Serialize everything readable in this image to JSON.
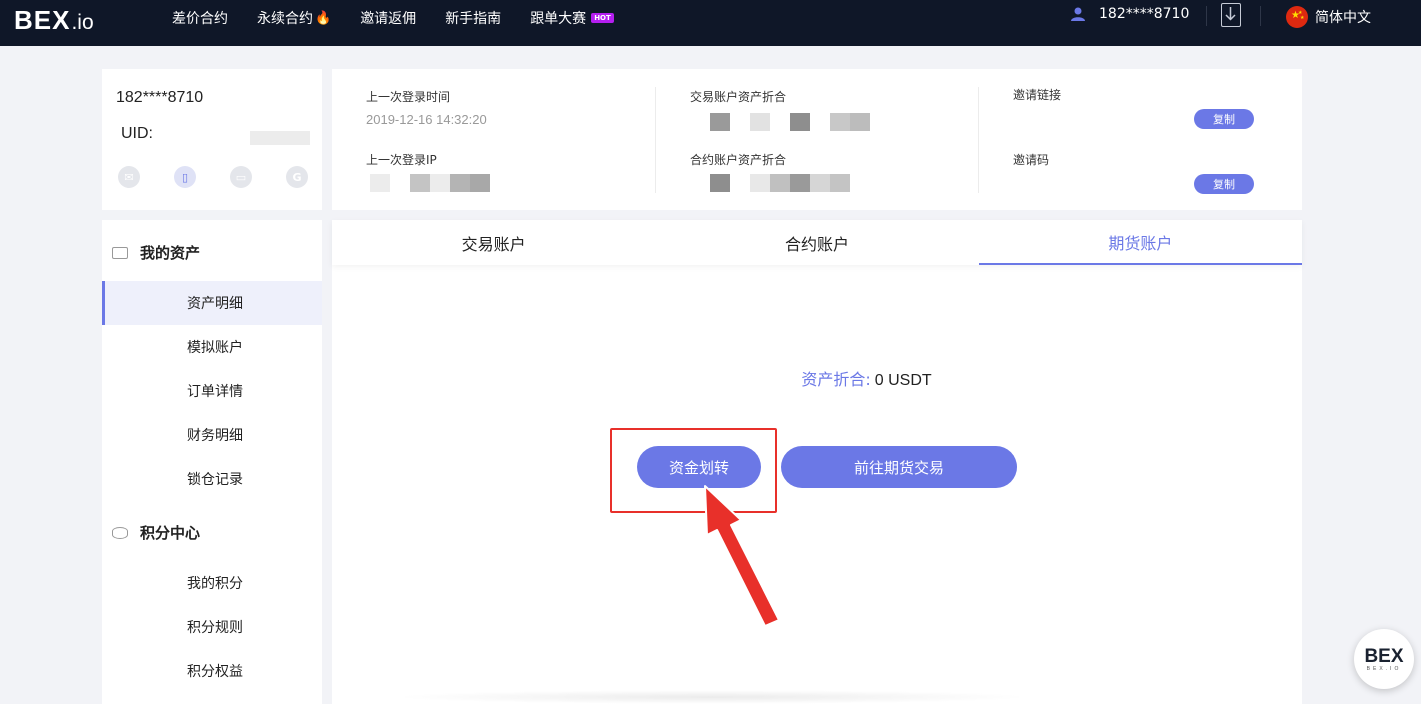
{
  "nav": {
    "logo_main": "BEX",
    "logo_suffix": ".io",
    "items": [
      {
        "label": "差价合约"
      },
      {
        "label": "永续合约"
      },
      {
        "label": "邀请返佣"
      },
      {
        "label": "新手指南"
      },
      {
        "label": "跟单大赛",
        "badge": "HOT"
      }
    ],
    "user": "182****8710",
    "language": "简体中文"
  },
  "profile": {
    "phone": "182****8710",
    "uid_label": "UID:",
    "bind_icons": [
      "mail-icon",
      "phone-icon",
      "card-icon",
      "google-icon"
    ]
  },
  "info": {
    "last_login_time_label": "上一次登录时间",
    "last_login_time": "2019-12-16 14:32:20",
    "last_login_ip_label": "上一次登录IP",
    "trade_assets_label": "交易账户资产折合",
    "contract_assets_label": "合约账户资产折合",
    "invite_link_label": "邀请链接",
    "invite_code_label": "邀请码",
    "copy_label": "复制"
  },
  "sidebar": {
    "assets_title": "我的资产",
    "assets_items": [
      {
        "label": "资产明细",
        "active": true
      },
      {
        "label": "模拟账户"
      },
      {
        "label": "订单详情"
      },
      {
        "label": "财务明细"
      },
      {
        "label": "锁仓记录"
      }
    ],
    "points_title": "积分中心",
    "points_items": [
      {
        "label": "我的积分"
      },
      {
        "label": "积分规则"
      },
      {
        "label": "积分权益"
      }
    ]
  },
  "main": {
    "tabs": [
      {
        "label": "交易账户"
      },
      {
        "label": "合约账户"
      },
      {
        "label": "期货账户",
        "active": true
      }
    ],
    "balance_label": "资产折合:",
    "balance_value": "0 USDT",
    "transfer_button": "资金划转",
    "futures_button": "前往期货交易"
  },
  "float_logo": {
    "main": "BEX",
    "sub": "BEX.IO"
  },
  "colors": {
    "accent": "#6b78e6",
    "nav_bg": "#0f1728",
    "highlight": "#e8302a"
  }
}
